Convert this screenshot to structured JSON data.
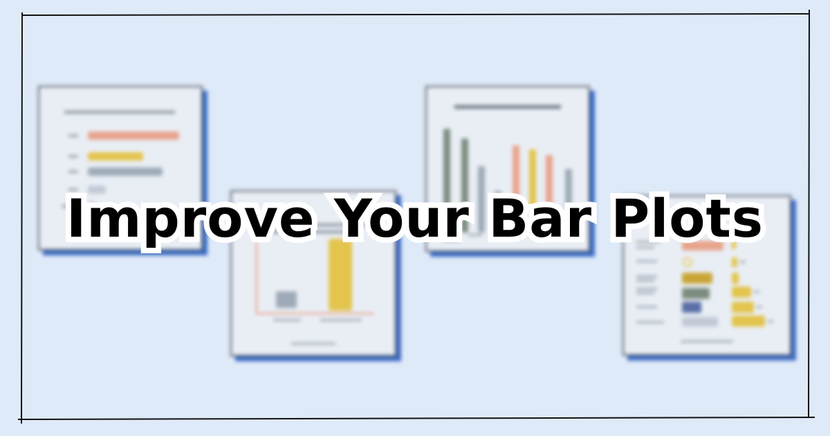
{
  "headline": "Improve Your Bar Plots",
  "colors": {
    "background": "#dfeaf9",
    "card_shadow": "#3c6cc4",
    "salmon": "#e8a48c",
    "mustard": "#e3c44c",
    "slate": "#9eaab7",
    "sage": "#7c8c80",
    "navy": "#5a6fa6",
    "pale": "#c3cad6"
  },
  "thumbnail_icons": [
    "horizontal-bar-chart-icon",
    "vertical-bar-chart-icon",
    "grouped-bar-chart-icon",
    "table-bar-chart-icon"
  ]
}
